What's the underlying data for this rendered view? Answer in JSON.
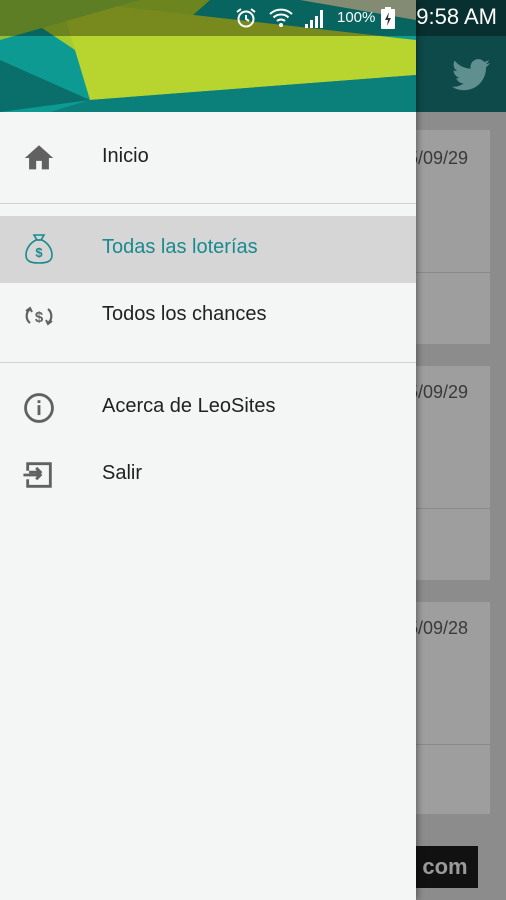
{
  "status_bar": {
    "battery_percent": "100%",
    "time": "9:58 AM",
    "icons": [
      "alarm-icon",
      "wifi-icon",
      "signal-icon",
      "battery-icon"
    ]
  },
  "background": {
    "dates": [
      "5/09/29",
      "5/09/29",
      "5/09/28"
    ],
    "ad_text": "com"
  },
  "drawer": {
    "accent_color": "#198a8f",
    "items": [
      {
        "label": "Inicio",
        "icon": "home-icon",
        "active": false
      },
      {
        "label": "Todas las loterías",
        "icon": "money-bag-icon",
        "active": true
      },
      {
        "label": "Todos los chances",
        "icon": "money-exchange-icon",
        "active": false
      },
      {
        "label": "Acerca de LeoSites",
        "icon": "info-icon",
        "active": false
      },
      {
        "label": "Salir",
        "icon": "exit-icon",
        "active": false
      }
    ]
  }
}
